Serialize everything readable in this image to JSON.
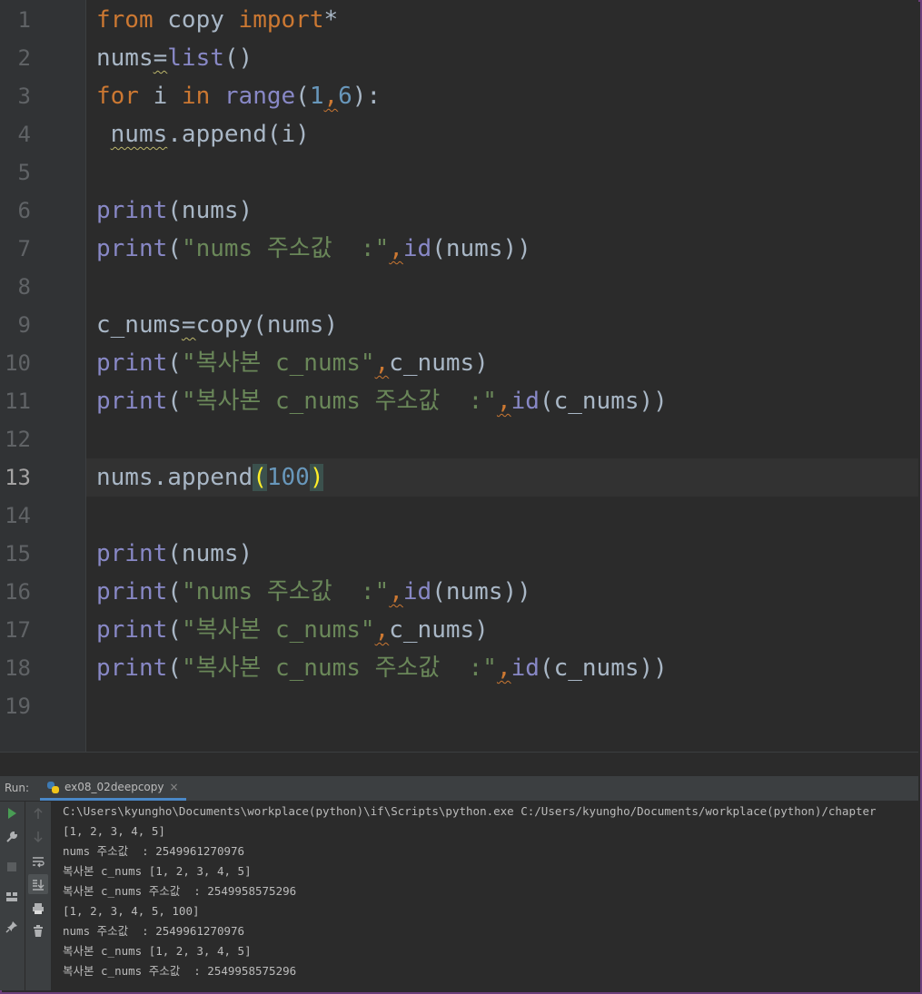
{
  "editor": {
    "line_numbers": [
      "1",
      "2",
      "3",
      "4",
      "5",
      "6",
      "7",
      "8",
      "9",
      "10",
      "11",
      "12",
      "13",
      "14",
      "15",
      "16",
      "17",
      "18",
      "19"
    ],
    "current_line": "13",
    "code": {
      "l1_from": "from",
      "l1_mod": " copy ",
      "l1_import": "import",
      "l1_star": "*",
      "l2_var": "nums",
      "l2_eq": "=",
      "l2_fn": "list",
      "l2_paren": "()",
      "l3_for": "for",
      "l3_i": " i ",
      "l3_in": "in",
      "l3_range": " range",
      "l3_open": "(",
      "l3_n1": "1",
      "l3_comma": ",",
      "l3_n2": "6",
      "l3_close": "):",
      "l4_indent": " ",
      "l4_var": "nums",
      "l4_rest": ".append(i)",
      "print": "print",
      "l6_args": "(nums)",
      "l7_open": "(",
      "l7_str": "\"nums 주소값  :\"",
      "comma": ",",
      "id": "id",
      "l7_tail": "(nums))",
      "l9_var": "c_nums",
      "l9_eq": "=",
      "l9_rest": "copy(nums)",
      "l10_str": "\"복사본 c_nums\"",
      "l10_tail": "c_nums)",
      "l11_str": "\"복사본 c_nums 주소값  :\"",
      "l11_tail": "(c_nums))",
      "l13_head": "nums.append",
      "l13_open": "(",
      "l13_num": "100",
      "l13_close": ")"
    }
  },
  "run_panel": {
    "label": "Run:",
    "tab_name": "ex08_02deepcopy",
    "tab_close": "×",
    "output": [
      "C:\\Users\\kyungho\\Documents\\workplace(python)\\if\\Scripts\\python.exe C:/Users/kyungho/Documents/workplace(python)/chapter",
      "[1, 2, 3, 4, 5]",
      "nums 주소값  : 2549961270976",
      "복사본 c_nums [1, 2, 3, 4, 5]",
      "복사본 c_nums 주소값  : 2549958575296",
      "[1, 2, 3, 4, 5, 100]",
      "nums 주소값  : 2549961270976",
      "복사본 c_nums [1, 2, 3, 4, 5]",
      "복사본 c_nums 주소값  : 2549958575296"
    ]
  },
  "icons": [
    "run-icon",
    "wrench-icon",
    "stop-icon",
    "layout-icon",
    "pin-icon",
    "up-arrow-icon",
    "down-arrow-icon",
    "soft-wrap-icon",
    "scroll-to-end-icon",
    "print-icon",
    "trash-icon",
    "python-file-icon"
  ]
}
